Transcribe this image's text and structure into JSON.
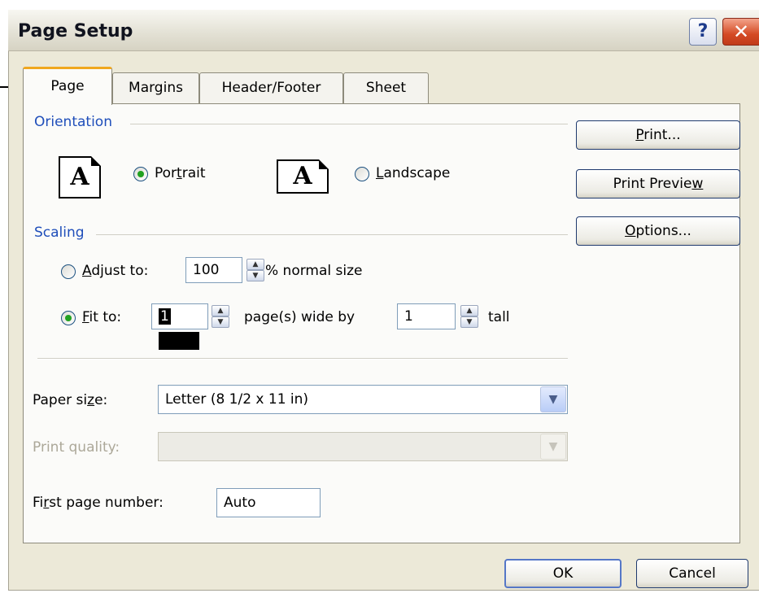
{
  "window": {
    "title": "Page Setup",
    "help_label": "?",
    "close_label": "✕"
  },
  "tabs": [
    "Page",
    "Margins",
    "Header/Footer",
    "Sheet"
  ],
  "orientation": {
    "group_label": "Orientation",
    "icon_letter": "A",
    "portrait_pre": "Por",
    "portrait_u": "t",
    "portrait_post": "rait",
    "landscape_u": "L",
    "landscape_post": "andscape",
    "selected": "Portrait"
  },
  "scaling": {
    "group_label": "Scaling",
    "adjust_pre": "",
    "adjust_u": "A",
    "adjust_post": "djust to:",
    "adjust_value": "100",
    "adjust_suffix": "% normal size",
    "fit_u": "F",
    "fit_post": "it to:",
    "fit_wide_value": "1",
    "fit_wide_suffix": "page(s) wide by",
    "fit_tall_value": "1",
    "fit_tall_suffix": "tall",
    "selected": "Fit to"
  },
  "paper_size": {
    "label_pre": "Paper si",
    "label_u": "z",
    "label_post": "e:",
    "value": "Letter (8 1/2 x 11 in)"
  },
  "print_quality": {
    "label": "Print quality:",
    "value": ""
  },
  "first_page": {
    "label_pre": "Fi",
    "label_u": "r",
    "label_post": "st page number:",
    "value": "Auto"
  },
  "side_buttons": {
    "print_u": "P",
    "print_post": "rint...",
    "preview_pre": "Print Previe",
    "preview_u": "w",
    "options_u": "O",
    "options_post": "ptions..."
  },
  "footer_buttons": {
    "ok": "OK",
    "cancel": "Cancel"
  }
}
